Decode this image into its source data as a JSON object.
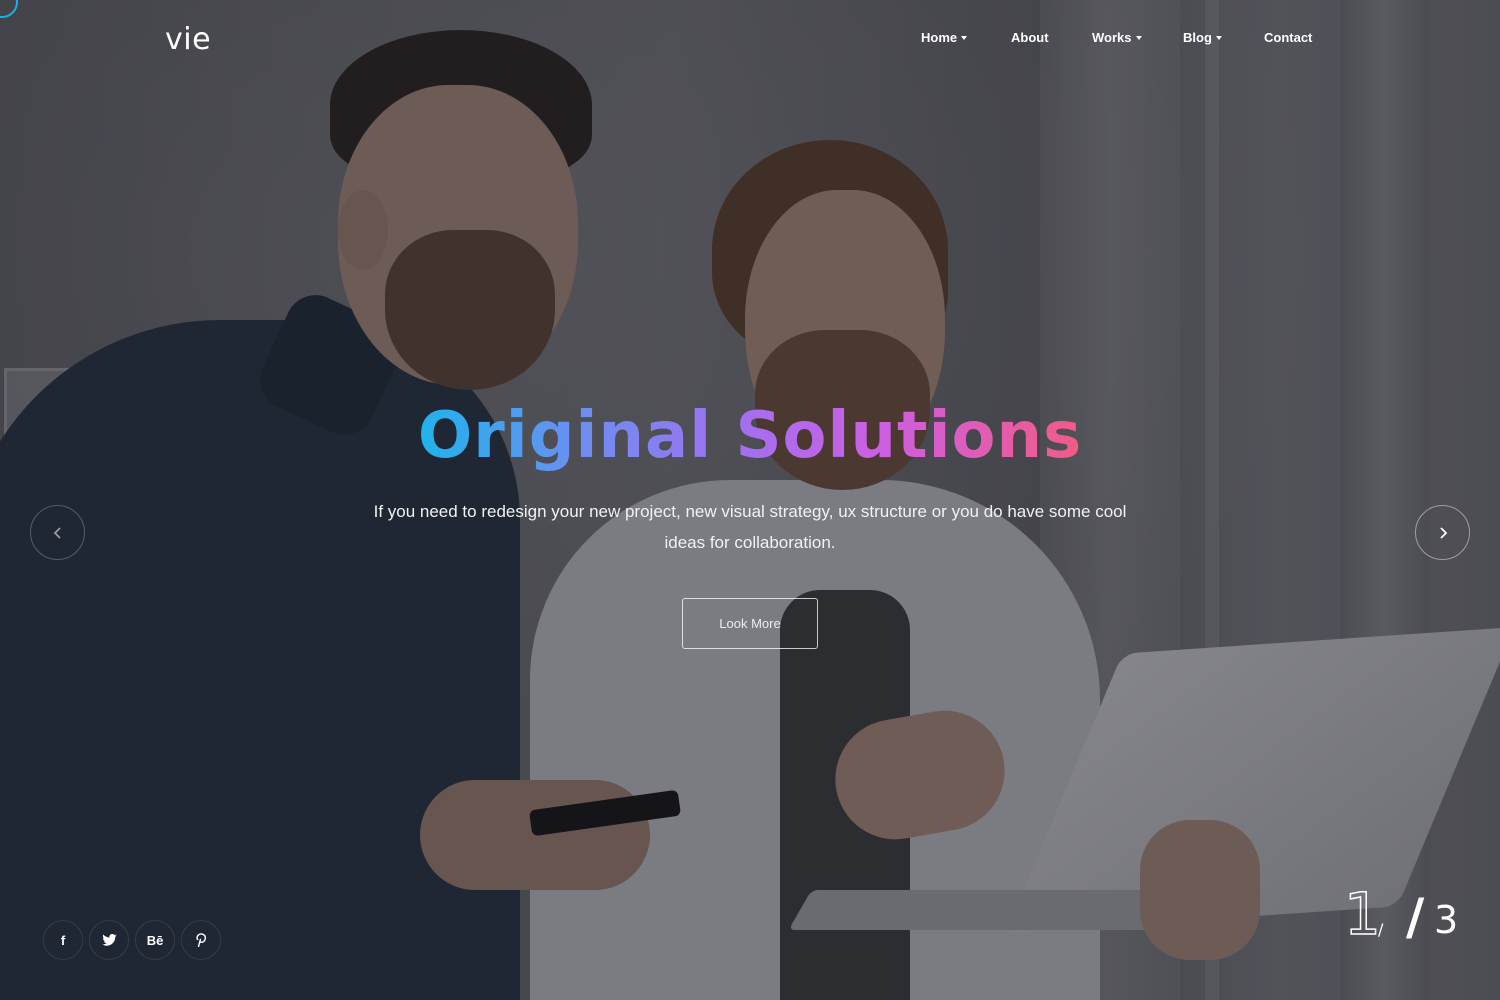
{
  "header": {
    "logo": "vie",
    "nav": [
      {
        "label": "Home",
        "has_dropdown": true
      },
      {
        "label": "About",
        "has_dropdown": false
      },
      {
        "label": "Works",
        "has_dropdown": true
      },
      {
        "label": "Blog",
        "has_dropdown": true
      },
      {
        "label": "Contact",
        "has_dropdown": false
      }
    ]
  },
  "hero": {
    "headline": "Original Solutions",
    "subtitle": "If you need to redesign your new project, new visual strategy, ux structure or you do have some cool ideas for collaboration.",
    "cta_label": "Look More",
    "headline_gradient": [
      "#1fb3ec",
      "#a170f0",
      "#f25b86"
    ]
  },
  "slider": {
    "prev_icon": "chevron-left-icon",
    "next_icon": "chevron-right-icon",
    "current": "1",
    "separator_small": "/",
    "separator": "/",
    "total": "3"
  },
  "social": [
    {
      "icon": "facebook-icon",
      "glyph": "f"
    },
    {
      "icon": "twitter-icon",
      "glyph": ""
    },
    {
      "icon": "behance-icon",
      "glyph": "Bē"
    },
    {
      "icon": "pinterest-icon",
      "glyph": ""
    }
  ],
  "colors": {
    "accent": "#16b0e9"
  }
}
